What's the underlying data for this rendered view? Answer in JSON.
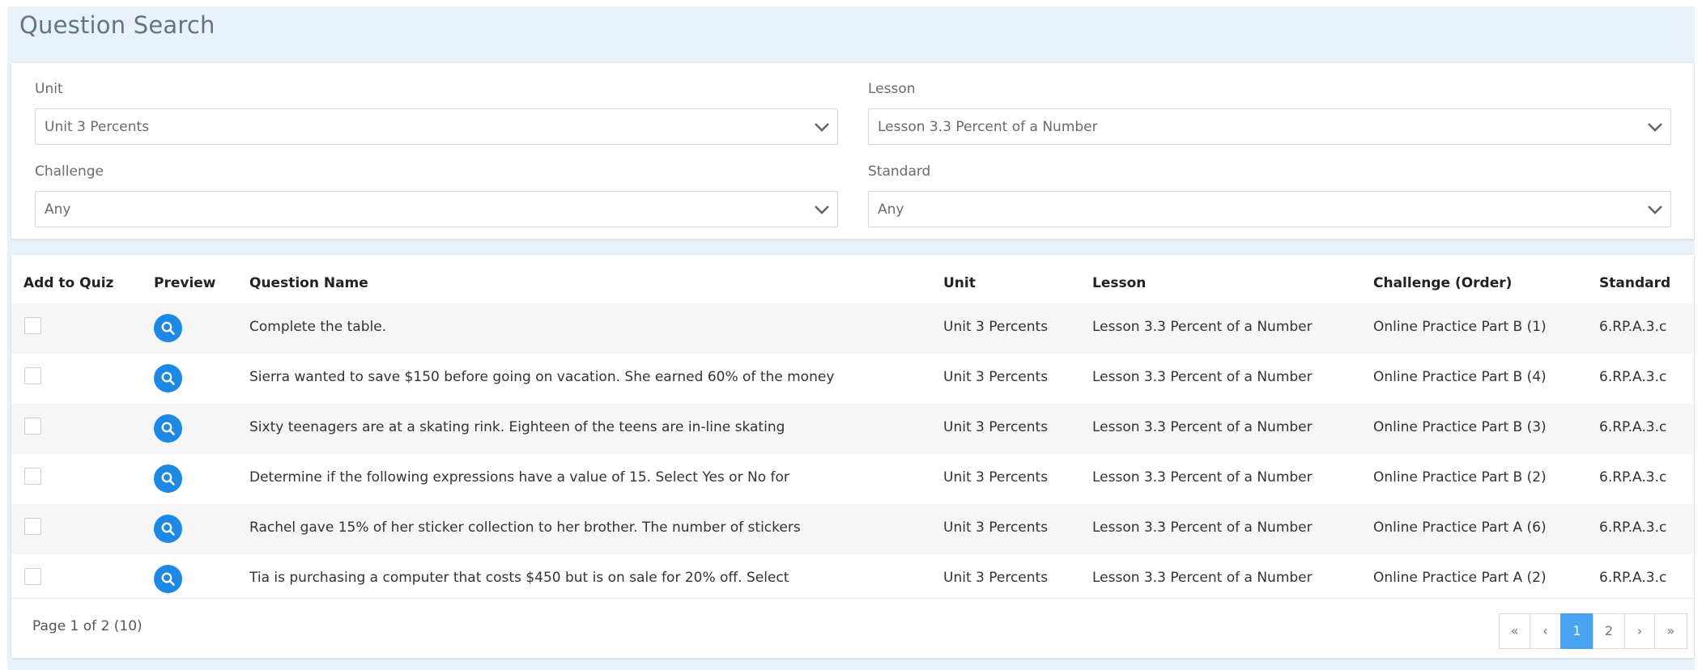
{
  "header": {
    "title": "Question Search"
  },
  "filters": {
    "unit": {
      "label": "Unit",
      "value": "Unit 3 Percents"
    },
    "lesson": {
      "label": "Lesson",
      "value": "Lesson 3.3 Percent of a Number"
    },
    "challenge": {
      "label": "Challenge",
      "value": "Any"
    },
    "standard": {
      "label": "Standard",
      "value": "Any"
    }
  },
  "table": {
    "headers": {
      "add": "Add to Quiz",
      "preview": "Preview",
      "name": "Question Name",
      "unit": "Unit",
      "lesson": "Lesson",
      "challenge": "Challenge (Order)",
      "standard": "Standard"
    },
    "rows": [
      {
        "name": "Complete the table.",
        "unit": "Unit 3 Percents",
        "lesson": "Lesson 3.3 Percent of a Number",
        "challenge": "Online Practice Part B (1)",
        "standard": "6.RP.A.3.c",
        "checked": false
      },
      {
        "name": "Sierra wanted to save $150 before going on vacation. She earned 60% of the money",
        "unit": "Unit 3 Percents",
        "lesson": "Lesson 3.3 Percent of a Number",
        "challenge": "Online Practice Part B (4)",
        "standard": "6.RP.A.3.c",
        "checked": false
      },
      {
        "name": "Sixty teenagers are at a skating rink. Eighteen of the teens are in-line skating",
        "unit": "Unit 3 Percents",
        "lesson": "Lesson 3.3 Percent of a Number",
        "challenge": "Online Practice Part B (3)",
        "standard": "6.RP.A.3.c",
        "checked": false
      },
      {
        "name": "Determine if the following expressions have a value of 15. Select Yes or No for",
        "unit": "Unit 3 Percents",
        "lesson": "Lesson 3.3 Percent of a Number",
        "challenge": "Online Practice Part B (2)",
        "standard": "6.RP.A.3.c",
        "checked": false
      },
      {
        "name": "Rachel gave 15% of her sticker collection to her brother. The number of stickers",
        "unit": "Unit 3 Percents",
        "lesson": "Lesson 3.3 Percent of a Number",
        "challenge": "Online Practice Part A (6)",
        "standard": "6.RP.A.3.c",
        "checked": false
      },
      {
        "name": "Tia is purchasing a computer that costs $450 but is on sale for 20% off. Select",
        "unit": "Unit 3 Percents",
        "lesson": "Lesson 3.3 Percent of a Number",
        "challenge": "Online Practice Part A (2)",
        "standard": "6.RP.A.3.c",
        "checked": false
      }
    ]
  },
  "pagination": {
    "info": "Page 1 of 2 (10)",
    "first": "«",
    "prev": "‹",
    "pages": [
      "1",
      "2"
    ],
    "current": "1",
    "next": "›",
    "last": "»"
  },
  "colors": {
    "accent": "#1e88e5",
    "active_page": "#4aa3f0",
    "header_bg": "#e9f2fa",
    "title": "#5f7687"
  },
  "icons": {
    "preview": "search-icon",
    "dropdown": "chevron-down-icon"
  }
}
